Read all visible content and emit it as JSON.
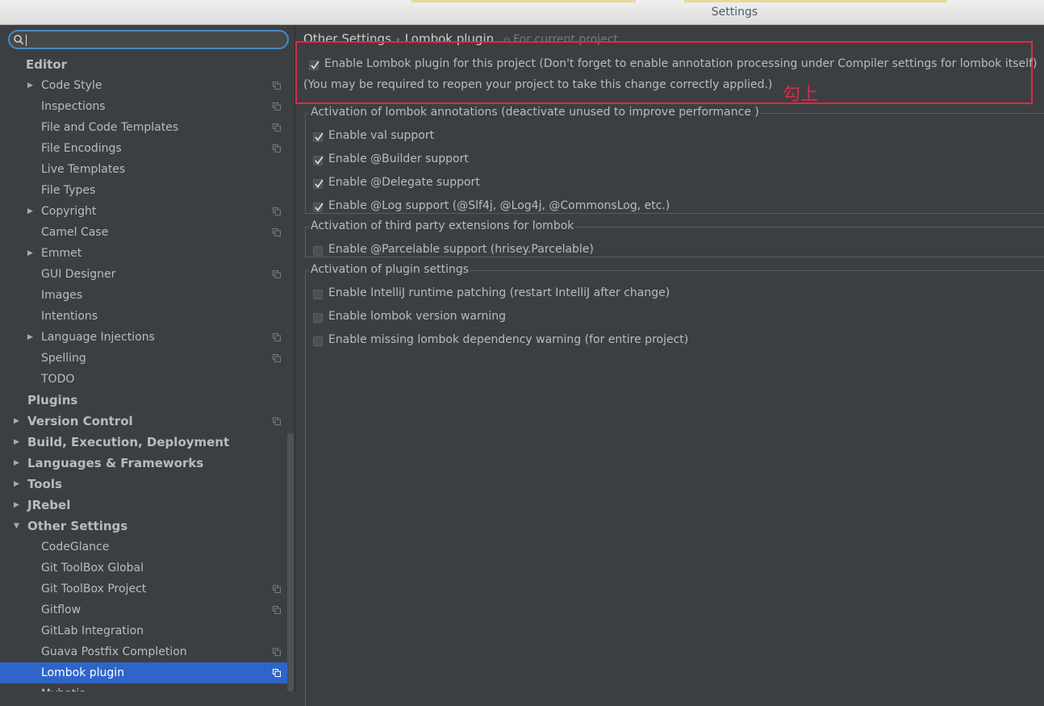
{
  "window": {
    "title": "Settings"
  },
  "search": {
    "value": "",
    "placeholder": ""
  },
  "sidebar": {
    "items": [
      {
        "label": "Editor",
        "level": 0,
        "expand": "",
        "copy": false
      },
      {
        "label": "Code Style",
        "level": 1,
        "expand": "collapsed",
        "copy": true
      },
      {
        "label": "Inspections",
        "level": 1,
        "expand": "",
        "copy": true
      },
      {
        "label": "File and Code Templates",
        "level": 1,
        "expand": "",
        "copy": true
      },
      {
        "label": "File Encodings",
        "level": 1,
        "expand": "",
        "copy": true
      },
      {
        "label": "Live Templates",
        "level": 1,
        "expand": "",
        "copy": false
      },
      {
        "label": "File Types",
        "level": 1,
        "expand": "",
        "copy": false
      },
      {
        "label": "Copyright",
        "level": 1,
        "expand": "collapsed",
        "copy": true
      },
      {
        "label": "Camel Case",
        "level": 1,
        "expand": "",
        "copy": true
      },
      {
        "label": "Emmet",
        "level": 1,
        "expand": "collapsed",
        "copy": false
      },
      {
        "label": "GUI Designer",
        "level": 1,
        "expand": "",
        "copy": true
      },
      {
        "label": "Images",
        "level": 1,
        "expand": "",
        "copy": false
      },
      {
        "label": "Intentions",
        "level": 1,
        "expand": "",
        "copy": false
      },
      {
        "label": "Language Injections",
        "level": 1,
        "expand": "collapsed",
        "copy": true
      },
      {
        "label": "Spelling",
        "level": 1,
        "expand": "",
        "copy": true
      },
      {
        "label": "TODO",
        "level": 1,
        "expand": "",
        "copy": false
      },
      {
        "label": "Plugins",
        "level": 0,
        "expand": "",
        "copy": false
      },
      {
        "label": "Version Control",
        "level": 0,
        "expand": "collapsed",
        "copy": true
      },
      {
        "label": "Build, Execution, Deployment",
        "level": 0,
        "expand": "collapsed",
        "copy": false
      },
      {
        "label": "Languages & Frameworks",
        "level": 0,
        "expand": "collapsed",
        "copy": false
      },
      {
        "label": "Tools",
        "level": 0,
        "expand": "collapsed",
        "copy": false
      },
      {
        "label": "JRebel",
        "level": 0,
        "expand": "collapsed",
        "copy": false
      },
      {
        "label": "Other Settings",
        "level": 0,
        "expand": "expanded",
        "copy": false
      },
      {
        "label": "CodeGlance",
        "level": 1,
        "expand": "",
        "copy": false
      },
      {
        "label": "Git ToolBox Global",
        "level": 1,
        "expand": "",
        "copy": false
      },
      {
        "label": "Git ToolBox Project",
        "level": 1,
        "expand": "",
        "copy": true
      },
      {
        "label": "Gitflow",
        "level": 1,
        "expand": "",
        "copy": true
      },
      {
        "label": "GitLab Integration",
        "level": 1,
        "expand": "",
        "copy": false
      },
      {
        "label": "Guava Postfix Completion",
        "level": 1,
        "expand": "",
        "copy": true
      },
      {
        "label": "Lombok plugin",
        "level": 1,
        "expand": "",
        "copy": true,
        "selected": true
      },
      {
        "label": "Mybatis",
        "level": 1,
        "expand": "",
        "copy": false
      }
    ]
  },
  "breadcrumb": {
    "parent": "Other Settings",
    "separator": "›",
    "current": "Lombok plugin",
    "scope": "For current project"
  },
  "main": {
    "enable_plugin": {
      "label": "Enable Lombok plugin for this project (Don't forget to enable annotation processing under Compiler settings for lombok itself)",
      "checked": true
    },
    "reopen_note": "(You may be required to reopen your project to take this change correctly applied.)",
    "annotation": "勾上",
    "groups": [
      {
        "legend": "Activation of lombok annotations (deactivate unused to improve performance )",
        "options": [
          {
            "label": "Enable val support",
            "checked": true
          },
          {
            "label": "Enable @Builder support",
            "checked": true
          },
          {
            "label": "Enable @Delegate support",
            "checked": true
          },
          {
            "label": "Enable @Log support (@Slf4j, @Log4j, @CommonsLog, etc.)",
            "checked": true
          }
        ]
      },
      {
        "legend": "Activation of third party extensions for lombok",
        "options": [
          {
            "label": "Enable @Parcelable support (hrisey.Parcelable)",
            "checked": false
          }
        ]
      },
      {
        "legend": "Activation of plugin settings",
        "options": [
          {
            "label": "Enable IntelliJ runtime patching (restart IntelliJ after change)",
            "checked": false
          },
          {
            "label": "Enable lombok version warning",
            "checked": false
          },
          {
            "label": "Enable missing lombok dependency warning (for entire project)",
            "checked": false
          }
        ]
      }
    ]
  },
  "colors": {
    "selection": "#2f65ca",
    "annotation": "#e0284a",
    "search_border": "#4a88c7"
  }
}
